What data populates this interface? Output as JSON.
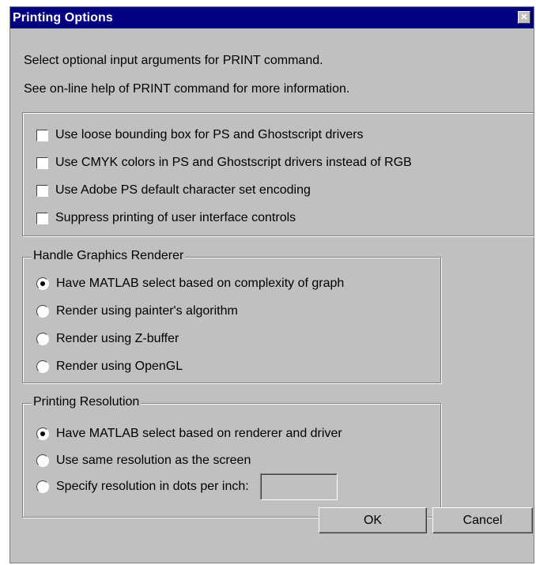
{
  "window": {
    "title": "Printing Options",
    "close_glyph": "✕"
  },
  "description": [
    "Select optional input arguments for PRINT command.",
    "See on-line help of PRINT command for more information."
  ],
  "options": [
    {
      "label": "Use loose bounding box for PS and Ghostscript drivers",
      "checked": false
    },
    {
      "label": "Use CMYK colors in PS and Ghostscript drivers instead of RGB",
      "checked": false
    },
    {
      "label": "Use Adobe PS default character set encoding",
      "checked": false
    },
    {
      "label": "Suppress printing of user interface controls",
      "checked": false
    }
  ],
  "renderer": {
    "title": "Handle Graphics Renderer",
    "items": [
      {
        "label": "Have MATLAB select based on complexity of graph",
        "selected": true
      },
      {
        "label": "Render using painter's algorithm",
        "selected": false
      },
      {
        "label": "Render using Z-buffer",
        "selected": false
      },
      {
        "label": "Render using OpenGL",
        "selected": false
      }
    ]
  },
  "resolution": {
    "title": "Printing Resolution",
    "items": [
      {
        "label": "Have MATLAB select based on renderer and driver",
        "selected": true
      },
      {
        "label": "Use same resolution as the screen",
        "selected": false
      },
      {
        "label": "Specify resolution in dots per inch:",
        "selected": false
      }
    ],
    "dpi_value": ""
  },
  "buttons": {
    "ok": "OK",
    "cancel": "Cancel"
  }
}
